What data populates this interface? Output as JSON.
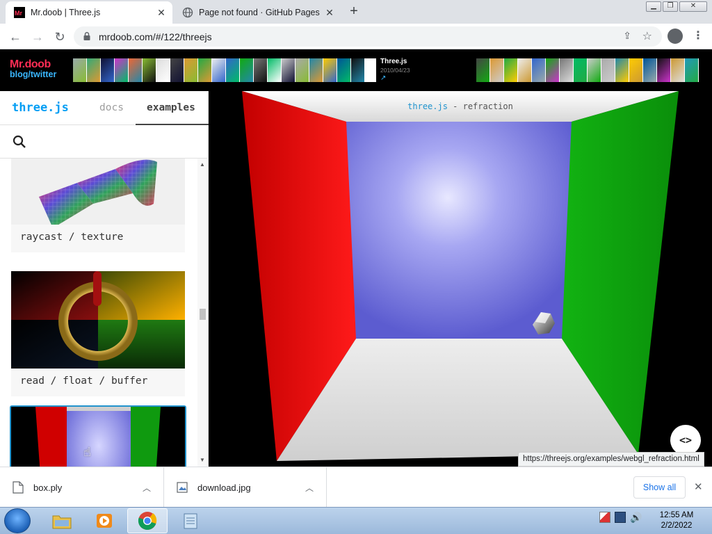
{
  "browser": {
    "tabs": [
      {
        "title": "Mr.doob | Three.js",
        "favicon": "mrdoob-favicon",
        "active": true
      },
      {
        "title": "Page not found · GitHub Pages",
        "favicon": "globe-icon",
        "active": false
      }
    ],
    "url": "mrdoob.com/#/122/threejs",
    "status_url": "https://threejs.org/examples/webgl_refraction.html"
  },
  "site_header": {
    "logo_line1": "Mr.doob",
    "logo_line2": "blog/twitter",
    "project_name": "Three.js",
    "project_date": "2010/04/23",
    "project_link_icon": "external-link-icon"
  },
  "panel": {
    "brand": "three.js",
    "nav": {
      "docs": "docs",
      "examples": "examples"
    },
    "search_value": "",
    "cards": [
      {
        "caption": "raycast / texture"
      },
      {
        "caption": "read / float / buffer"
      },
      {
        "caption": ""
      }
    ]
  },
  "viewport": {
    "title_link": "three.js",
    "title_rest": " - refraction",
    "code_button": "<>"
  },
  "downloads": {
    "items": [
      {
        "name": "box.ply",
        "icon": "file-icon"
      },
      {
        "name": "download.jpg",
        "icon": "image-file-icon"
      }
    ],
    "show_all": "Show all"
  },
  "taskbar": {
    "time": "12:55 AM",
    "date": "2/2/2022"
  },
  "colors": {
    "accent": "#049ef4",
    "link": "#2194ce",
    "logo_red": "#ff2d55"
  }
}
